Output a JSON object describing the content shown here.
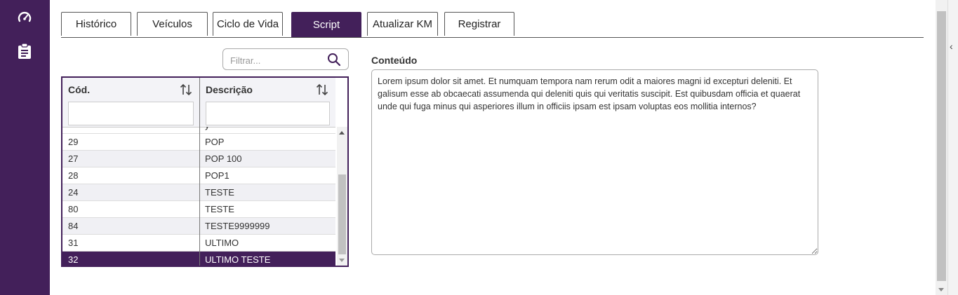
{
  "colors": {
    "brand": "#43205a",
    "row_alt": "#f0f0f4"
  },
  "sidebar": {
    "items": [
      {
        "icon": "dashboard-gauge-icon"
      },
      {
        "icon": "clipboard-icon"
      }
    ]
  },
  "tabs": [
    {
      "label": "Histórico",
      "active": false
    },
    {
      "label": "Veículos",
      "active": false
    },
    {
      "label": "Ciclo de Vida",
      "active": false
    },
    {
      "label": "Script",
      "active": true
    },
    {
      "label": "Atualizar KM",
      "active": false
    },
    {
      "label": "Registrar",
      "active": false
    }
  ],
  "filter": {
    "placeholder": "Filtrar...",
    "icon": "search-icon"
  },
  "grid": {
    "columns": [
      {
        "label": "Cód.",
        "sort_icon": "sort-icon"
      },
      {
        "label": "Descrição",
        "sort_icon": "sort-icon"
      }
    ],
    "partial_top_row": {
      "code": "",
      "description": "y"
    },
    "rows": [
      {
        "code": "29",
        "description": "POP"
      },
      {
        "code": "27",
        "description": "POP 100"
      },
      {
        "code": "28",
        "description": "POP1"
      },
      {
        "code": "24",
        "description": "TESTE"
      },
      {
        "code": "80",
        "description": "TESTE"
      },
      {
        "code": "84",
        "description": "TESTE9999999"
      },
      {
        "code": "31",
        "description": "ULTIMO"
      },
      {
        "code": "32",
        "description": "ULTIMO TESTE"
      }
    ],
    "selected_code": "32"
  },
  "content": {
    "label": "Conteúdo",
    "text": "Lorem ipsum dolor sit amet. Et numquam tempora nam rerum odit a maiores magni id excepturi deleniti. Et galisum esse ab obcaecati assumenda qui deleniti quis qui veritatis suscipit. Est quibusdam officia et quaerat unde qui fuga minus qui asperiores illum in officiis ipsam est ipsam voluptas eos mollitia internos?"
  },
  "right_panel": {
    "collapse_icon": "chevron-left-icon",
    "collapse_glyph": "‹"
  }
}
